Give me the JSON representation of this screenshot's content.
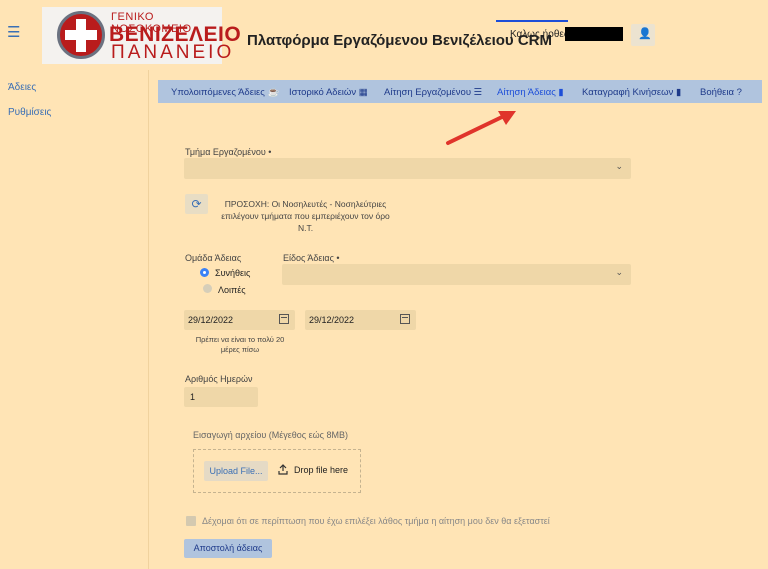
{
  "header": {
    "menu_icon": "☰",
    "logo": {
      "line1": "ΓΕΝΙΚΟ ΝΟΣΟΚΟΜΕΙΟ",
      "line2": "ΒΕΝΙΖΕΛΕΙΟ",
      "line3": "ΠΑΝΑΝΕΙΟ"
    },
    "title": "Πλατφόρμα Εργαζόμενου Βενιζέλειου CRM",
    "welcome": "Καλως ήρθες",
    "user_icon": "👤"
  },
  "sidebar": {
    "items": [
      {
        "label": "Άδειες"
      },
      {
        "label": "Ρυθμίσεις"
      }
    ]
  },
  "nav": {
    "tabs": [
      {
        "label": "Υπολοιπόμενες Άδειες ☕"
      },
      {
        "label": "Ιστορικό Αδειών ▦"
      },
      {
        "label": "Αίτηση Εργαζομένου ☰"
      },
      {
        "label": "Αίτηση Άδειας ▮"
      },
      {
        "label": "Καταγραφή Κινήσεων ▮"
      },
      {
        "label": "Βοήθεια ?"
      }
    ],
    "active_tab": "Αίτηση Άδειας"
  },
  "form": {
    "department_label": "Τμήμα Εργαζομένου •",
    "department_value": "",
    "refresh_icon": "⟳",
    "warning": "ΠΡΟΣΟΧΗ: Οι Νοσηλευτές - Νοσηλεύτριες επιλέγουν τμήματα που εμπεριέχουν τον όρο Ν.Τ.",
    "group_label": "Ομάδα Άδειας",
    "group_options": [
      "Συνήθεις",
      "Λοιπές"
    ],
    "group_selected": "Συνήθεις",
    "type_label": "Είδος Άδειας •",
    "type_value": "",
    "date_from": "29/12/2022",
    "date_to": "29/12/2022",
    "date_hint": "Πρέπει να είναι το πολύ 20 μέρες πίσω",
    "days_label": "Αριθμός Ημερών",
    "days_value": "1",
    "file_label": "Εισαγωγή αρχείου (Μέγεθος εώς 8MB)",
    "upload_button": "Upload File...",
    "drop_text": "Drop file here",
    "consent_text": "Δέχομαι ότι σε περίπτωση που έχω επιλέξει λάθος τμήμα η αίτηση μου δεν θα εξεταστεί",
    "submit_button": "Αποστολή άδειας"
  },
  "colors": {
    "background": "#ffe4b5",
    "nav_bar": "#b0c4de",
    "accent": "#3a6fb5",
    "annotation_arrow": "#e0342b"
  }
}
